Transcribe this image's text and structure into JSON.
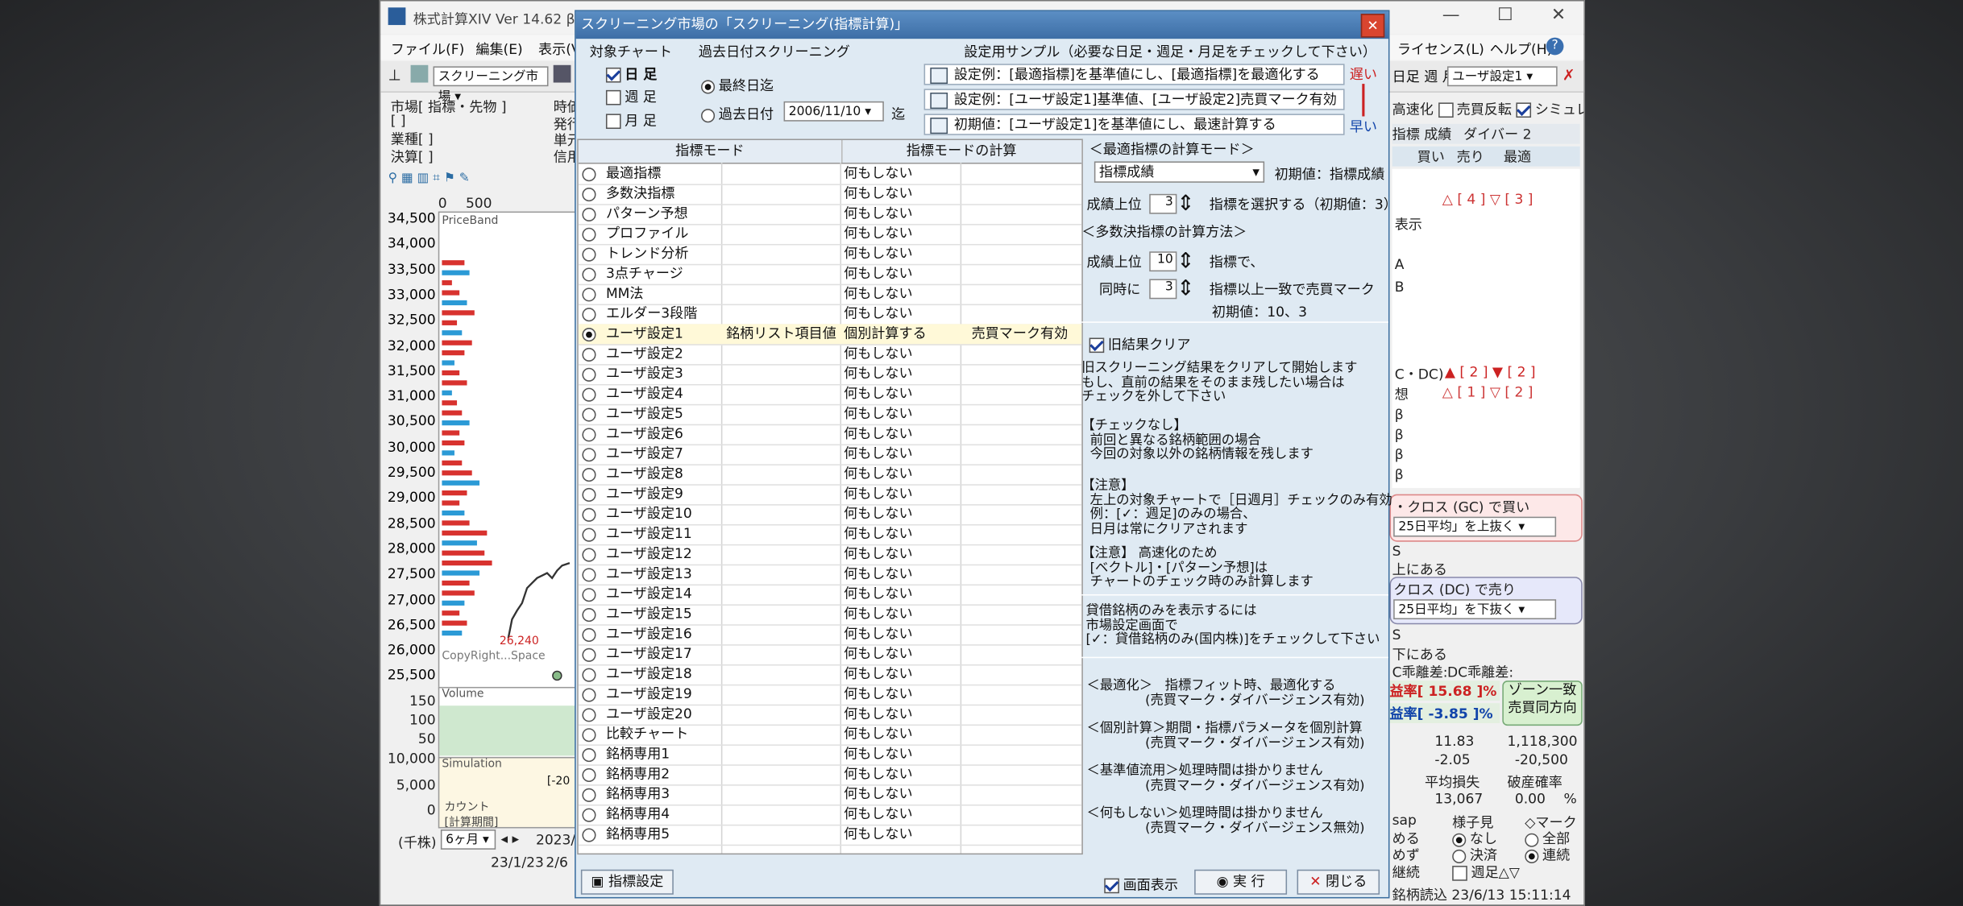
{
  "app": {
    "title": "株式計算XIV Ver 14.62 β",
    "menus": [
      "ファイル(F)",
      "編集(E)",
      "表示(V)"
    ],
    "menus_right": [
      "ライセンス(L)",
      "ヘルプ(H)"
    ],
    "toolbar_select": "スクリーニング市場",
    "right_select": "ユーザ設定1",
    "right_tab_label": "日足 週 月 全",
    "left_panel": {
      "market": "市場[ 指標・先物 ]",
      "bracket1": "[ ]",
      "bracket2": "[ ]",
      "industry": "業種[ ]",
      "settlement": "決算[ ]",
      "col_time": "時価",
      "col_issue": "発行",
      "col_unit": "単元",
      "col_credit": "信用"
    },
    "chart": {
      "x_ticks": [
        "0",
        "500"
      ],
      "y_labels": [
        "34,500",
        "34,000",
        "33,500",
        "33,000",
        "32,500",
        "32,000",
        "31,500",
        "31,000",
        "30,500",
        "30,000",
        "29,500",
        "29,000",
        "28,500",
        "28,000",
        "27,500",
        "27,000",
        "26,500",
        "26,000",
        "25,500"
      ],
      "vol_labels": [
        "150",
        "100",
        "50"
      ],
      "sim_labels": [
        "10,000",
        "5,000",
        "0"
      ],
      "price_band": "PriceBand",
      "copyright": "CopyRight...Space",
      "low_marker": "26,240",
      "volume": "Volume",
      "simulation": "Simulation",
      "count_label": "カウント",
      "calc_label": "[計算期間]",
      "minus20": "[-20",
      "period": "(千株)",
      "span": "6ヶ月",
      "date1": "23/1/23",
      "date2": "2/6",
      "date3": "2023/"
    },
    "right_panel": {
      "toggles": [
        "高速化",
        "売買反転",
        "シミュレ"
      ],
      "tabs": [
        "指標",
        "成績",
        "ダイバー"
      ],
      "tab_nums": "2",
      "cols": [
        "買い",
        "売り",
        "最適"
      ],
      "rows": [
        "△ [ 4 ] ▽ [ 3 ]",
        "表示",
        "A",
        "B",
        "C・DC)",
        "想",
        "β",
        "β",
        "β",
        "β"
      ],
      "row_gc": "▲ [ 2 ] ▼ [ 2 ]",
      "row_pred": "△ [ 1 ] ▽ [ 2 ]",
      "gc_title": "・クロス (GC) で買い",
      "gc_select": "25日平均」を上抜く",
      "s_label": "S",
      "above": "上にある",
      "dc_title": "クロス (DC) で売り",
      "dc_select": "25日平均」を下抜く",
      "below": "下にある",
      "dc_div": "DC乖離差:",
      "gc_div": "C乖離差:",
      "rate1_label": "益率[",
      "rate1": "15.68",
      "rate1_pct": "]%",
      "rate2_label": "益率[",
      "rate2": "-3.85",
      "rate2_pct": "]%",
      "zone": "ゾーン一致",
      "zone2": "売買同方向",
      "v1": "11.83",
      "v1b": "1,118,300",
      "v2": "-2.05",
      "v2b": "-20,500",
      "avg_loss": "平均損失",
      "bk_rate": "破産確率",
      "v3": "13,067",
      "v3b": "0.00",
      "pct": "%",
      "sap": "sap",
      "state_title": "様子見",
      "mark_title": "◇マーク",
      "opts": [
        "める",
        "なし",
        "めず",
        "決済",
        "継続"
      ],
      "mark_opts": [
        "全部",
        "連続"
      ],
      "week": "週足△▽",
      "loaded": "銘柄読込 23/6/13 15:11:14"
    }
  },
  "dialog": {
    "title": "スクリーニング市場の「スクリーニング(指標計算)」",
    "target_chart": "対象チャート",
    "daily": "日 足",
    "weekly": "週 足",
    "monthly": "月 足",
    "past_screen": "過去日付スクリーニング",
    "latest": "最終日迄",
    "past_date": "過去日付",
    "date_value": "2006/11/10",
    "made": "迄",
    "sample_title": "設定用サンプル（必要な日足・週足・月足をチェックして下さい）",
    "samples": [
      "設定例：[最適指標]を基準値にし、[最適指標]を最適化する",
      "設定例：[ユーザ設定1]基準値、[ユーザ設定2]売買マーク有効",
      "初期値：[ユーザ設定1]を基準値にし、最速計算する"
    ],
    "speed_slow": "遅い",
    "speed_fast": "早い",
    "grid": {
      "h_mode": "指標モード",
      "h_calc": "指標モードの計算",
      "rows": [
        {
          "name": "最適指標",
          "c2": "",
          "c3": "何もしない",
          "c4": ""
        },
        {
          "name": "多数決指標",
          "c2": "",
          "c3": "何もしない",
          "c4": ""
        },
        {
          "name": "パターン予想",
          "c2": "",
          "c3": "何もしない",
          "c4": ""
        },
        {
          "name": "プロファイル",
          "c2": "",
          "c3": "何もしない",
          "c4": ""
        },
        {
          "name": "トレンド分析",
          "c2": "",
          "c3": "何もしない",
          "c4": ""
        },
        {
          "name": "3点チャージ",
          "c2": "",
          "c3": "何もしない",
          "c4": ""
        },
        {
          "name": "MM法",
          "c2": "",
          "c3": "何もしない",
          "c4": ""
        },
        {
          "name": "エルダー3段階",
          "c2": "",
          "c3": "何もしない",
          "c4": ""
        },
        {
          "name": "ユーザ設定1",
          "c2": "銘柄リスト項目値",
          "c3": "個別計算する",
          "c4": "売買マーク有効"
        },
        {
          "name": "ユーザ設定2",
          "c2": "",
          "c3": "何もしない",
          "c4": ""
        },
        {
          "name": "ユーザ設定3",
          "c2": "",
          "c3": "何もしない",
          "c4": ""
        },
        {
          "name": "ユーザ設定4",
          "c2": "",
          "c3": "何もしない",
          "c4": ""
        },
        {
          "name": "ユーザ設定5",
          "c2": "",
          "c3": "何もしない",
          "c4": ""
        },
        {
          "name": "ユーザ設定6",
          "c2": "",
          "c3": "何もしない",
          "c4": ""
        },
        {
          "name": "ユーザ設定7",
          "c2": "",
          "c3": "何もしない",
          "c4": ""
        },
        {
          "name": "ユーザ設定8",
          "c2": "",
          "c3": "何もしない",
          "c4": ""
        },
        {
          "name": "ユーザ設定9",
          "c2": "",
          "c3": "何もしない",
          "c4": ""
        },
        {
          "name": "ユーザ設定10",
          "c2": "",
          "c3": "何もしない",
          "c4": ""
        },
        {
          "name": "ユーザ設定11",
          "c2": "",
          "c3": "何もしない",
          "c4": ""
        },
        {
          "name": "ユーザ設定12",
          "c2": "",
          "c3": "何もしない",
          "c4": ""
        },
        {
          "name": "ユーザ設定13",
          "c2": "",
          "c3": "何もしない",
          "c4": ""
        },
        {
          "name": "ユーザ設定14",
          "c2": "",
          "c3": "何もしない",
          "c4": ""
        },
        {
          "name": "ユーザ設定15",
          "c2": "",
          "c3": "何もしない",
          "c4": ""
        },
        {
          "name": "ユーザ設定16",
          "c2": "",
          "c3": "何もしない",
          "c4": ""
        },
        {
          "name": "ユーザ設定17",
          "c2": "",
          "c3": "何もしない",
          "c4": ""
        },
        {
          "name": "ユーザ設定18",
          "c2": "",
          "c3": "何もしない",
          "c4": ""
        },
        {
          "name": "ユーザ設定19",
          "c2": "",
          "c3": "何もしない",
          "c4": ""
        },
        {
          "name": "ユーザ設定20",
          "c2": "",
          "c3": "何もしない",
          "c4": ""
        },
        {
          "name": "比較チャート",
          "c2": "",
          "c3": "何もしない",
          "c4": ""
        },
        {
          "name": "銘柄専用1",
          "c2": "",
          "c3": "何もしない",
          "c4": ""
        },
        {
          "name": "銘柄専用2",
          "c2": "",
          "c3": "何もしない",
          "c4": ""
        },
        {
          "name": "銘柄専用3",
          "c2": "",
          "c3": "何もしない",
          "c4": ""
        },
        {
          "name": "銘柄専用4",
          "c2": "",
          "c3": "何もしない",
          "c4": ""
        },
        {
          "name": "銘柄専用5",
          "c2": "",
          "c3": "何もしない",
          "c4": ""
        }
      ]
    },
    "right": {
      "opt_title": "＜最適指標の計算モード＞",
      "opt_select": "指標成績",
      "opt_init": "初期値：指標成績",
      "rank_label": "成績上位",
      "rank_value": "3",
      "rank_text": "指標を選択する（初期値：3）",
      "maj_title": "＜多数決指標の計算方法＞",
      "maj_rank_label": "成績上位",
      "maj_rank_value": "10",
      "maj_rank_text": "指標で、",
      "same_label": "同時に",
      "same_value": "3",
      "same_text": "指標以上一致で売買マーク",
      "maj_init": "初期値：10、3",
      "clear_label": "旧結果クリア",
      "note1": "旧スクリーニング結果をクリアして開始します\nもし、直前の結果をそのまま残したい場合は\nチェックを外して下さい",
      "note2": "【チェックなし】\n  前回と異なる銘柄範囲の場合\n  今回の対象以外の銘柄情報を残します",
      "note3": "【注意】\n  左上の対象チャートで［日週月］チェックのみ有効\n  例：[✓：週足]のみの場合、\n  日月は常にクリアされます",
      "note4": "【注意】 高速化のため\n  [ベクトル]・[パターン予想]は\n  チャートのチェック時のみ計算します",
      "note5": " 貸借銘柄のみを表示するには\n 市場設定画面で\n [✓：貸借銘柄のみ(国内株)]をチェックして下さい",
      "note6": "＜最適化＞   指標フィット時、最適化する\n              (売買マーク・ダイバージェンス有効)",
      "note7": "＜個別計算＞期間・指標パラメータを個別計算\n              (売買マーク・ダイバージェンス有効)",
      "note8": "＜基準値流用＞処理時間は掛かりません\n              (売買マーク・ダイバージェンス有効)",
      "note9": "＜何もしない＞処理時間は掛かりません\n              (売買マーク・ダイバージェンス無効)"
    },
    "footer": {
      "settings": "指標設定",
      "screen_show": "画面表示",
      "run": "実 行",
      "close": "閉じる"
    }
  }
}
